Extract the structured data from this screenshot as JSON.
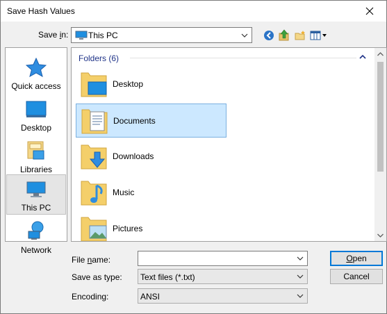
{
  "title": "Save Hash Values",
  "save_in": {
    "label_pre": "Save ",
    "label_key": "i",
    "label_post": "n:",
    "value": "This PC"
  },
  "toolbar": {
    "back": "back-arrow-icon",
    "up": "up-folder-icon",
    "new_folder": "new-folder-icon",
    "view": "view-menu-icon"
  },
  "places": [
    {
      "label": "Quick access",
      "icon": "star-icon"
    },
    {
      "label": "Desktop",
      "icon": "desktop-icon"
    },
    {
      "label": "Libraries",
      "icon": "libraries-icon"
    },
    {
      "label": "This PC",
      "icon": "computer-icon"
    },
    {
      "label": "Network",
      "icon": "network-icon"
    }
  ],
  "group": {
    "header": "Folders (6)"
  },
  "folders": [
    {
      "name": "Desktop",
      "icon": "desktop-folder-icon"
    },
    {
      "name": "Documents",
      "icon": "documents-folder-icon"
    },
    {
      "name": "Downloads",
      "icon": "downloads-folder-icon"
    },
    {
      "name": "Music",
      "icon": "music-folder-icon"
    },
    {
      "name": "Pictures",
      "icon": "pictures-folder-icon"
    }
  ],
  "form": {
    "file_name_pre": "File ",
    "file_name_key": "n",
    "file_name_post": "ame:",
    "file_name_value": "",
    "save_as_type_label": "Save as type:",
    "save_as_type_value": "Text files (*.txt)",
    "encoding_label": "Encoding:",
    "encoding_value": "ANSI"
  },
  "buttons": {
    "open_key": "O",
    "open_rest": "pen",
    "cancel": "Cancel"
  },
  "colors": {
    "selection": "#cce8ff",
    "group_header": "#1e3287",
    "accent": "#0078d7"
  }
}
